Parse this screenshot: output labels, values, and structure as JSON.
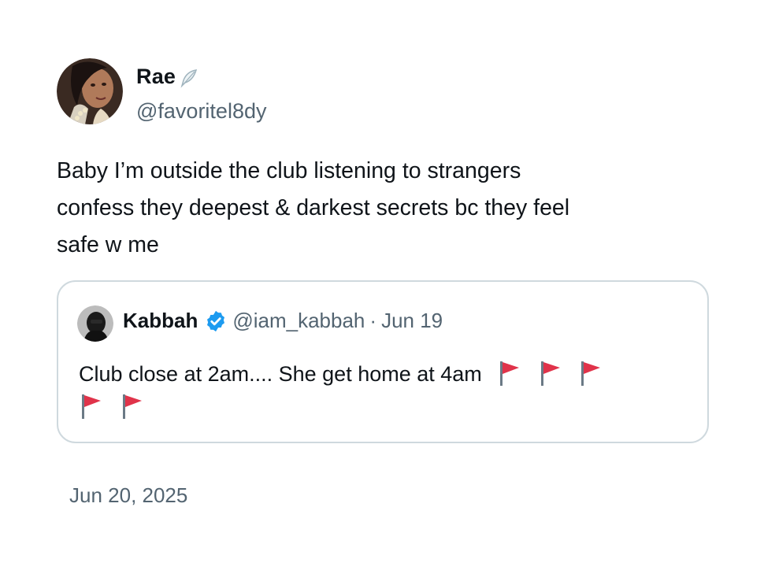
{
  "author": {
    "display_name": "Rae",
    "name_emoji_icon": "feather-icon",
    "handle": "@favoritel8dy",
    "avatar_icon": "profile-photo"
  },
  "tweet": {
    "text": "Baby I’m outside the club listening to strangers\nconfess they deepest & darkest secrets bc they feel\nsafe w me",
    "timestamp": "Jun 20, 2025"
  },
  "quoted": {
    "display_name": "Kabbah",
    "verified_icon": "verified-badge-icon",
    "handle": "@iam_kabbah",
    "separator": "·",
    "date": "Jun 19",
    "text": "Club close at 2am.... She get home at 4am",
    "flags": [
      "red-flag-icon",
      "red-flag-icon",
      "red-flag-icon",
      "red-flag-icon",
      "red-flag-icon"
    ]
  },
  "colors": {
    "text_primary": "#0f1419",
    "text_secondary": "#536471",
    "border": "#cfd9de",
    "verified_blue": "#1d9bf0",
    "flag_red": "#e0334a"
  }
}
